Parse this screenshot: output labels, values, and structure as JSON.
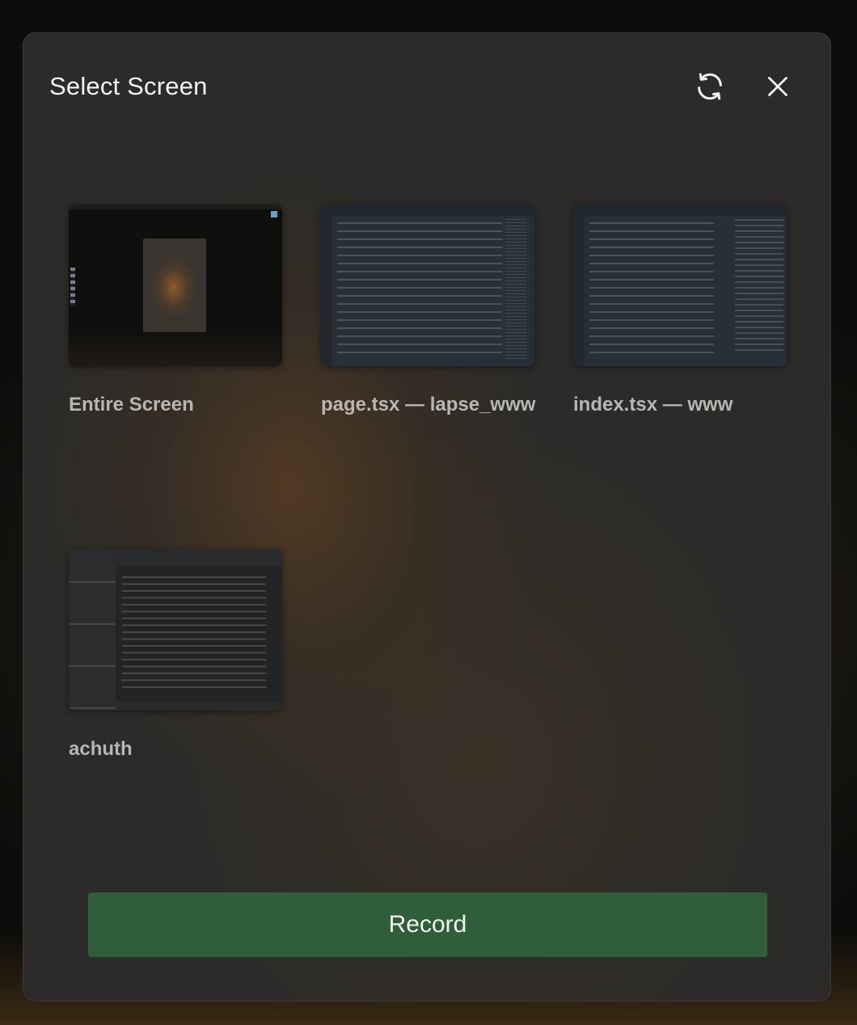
{
  "dialog": {
    "title": "Select Screen",
    "icons": {
      "refresh": "refresh-icon",
      "close": "close-icon"
    }
  },
  "sources": [
    {
      "label": "Entire Screen",
      "kind": "screen"
    },
    {
      "label": "page.tsx — lapse_www",
      "kind": "window"
    },
    {
      "label": "index.tsx — www",
      "kind": "window"
    },
    {
      "label": "achuth",
      "kind": "window"
    }
  ],
  "actions": {
    "record_label": "Record"
  },
  "colors": {
    "record_button": "#2f5f3a",
    "dialog_background": "#2c2b29",
    "label_text": "#b8b6b2"
  }
}
